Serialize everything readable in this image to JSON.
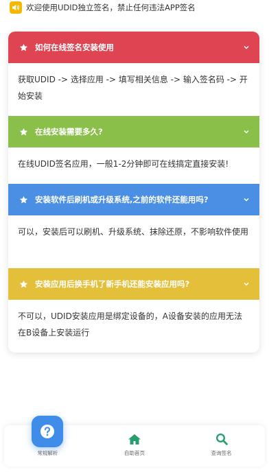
{
  "notice": {
    "text": "欢迎使用UDID独立签名，禁止任何违法APP签名"
  },
  "faq": [
    {
      "question": "如何在线签名安装使用",
      "answer": "获取UDID -> 选择应用 -> 填写相关信息 -> 输入签名码 -> 开始安装",
      "color": "#de4452"
    },
    {
      "question": "在线安装需要多久?",
      "answer": "在线UDID签名应用，一般1-2分钟即可在线搞定直接安装!",
      "color": "#8ac04a"
    },
    {
      "question": "安装软件后刷机或升级系统,之前的软件还能用吗?",
      "answer": "可以，安装后可以刷机、升级系统、抹除还原，不影响软件使用",
      "color": "#4a8fe3"
    },
    {
      "question": "安装应用后换手机了新手机还能安装应用吗?",
      "answer": "不可以，UDID安装应用是绑定设备的，A设备安装的应用无法在B设备上安装运行",
      "color": "#e4bf3a"
    }
  ],
  "bottom_nav": {
    "items": [
      {
        "label": "常规解析",
        "icon": "question-icon"
      },
      {
        "label": "自助首页",
        "icon": "home-icon"
      },
      {
        "label": "查询签名",
        "icon": "search-icon"
      }
    ],
    "accent": "#3f8de8",
    "icon_color": "#2a9d6e"
  }
}
